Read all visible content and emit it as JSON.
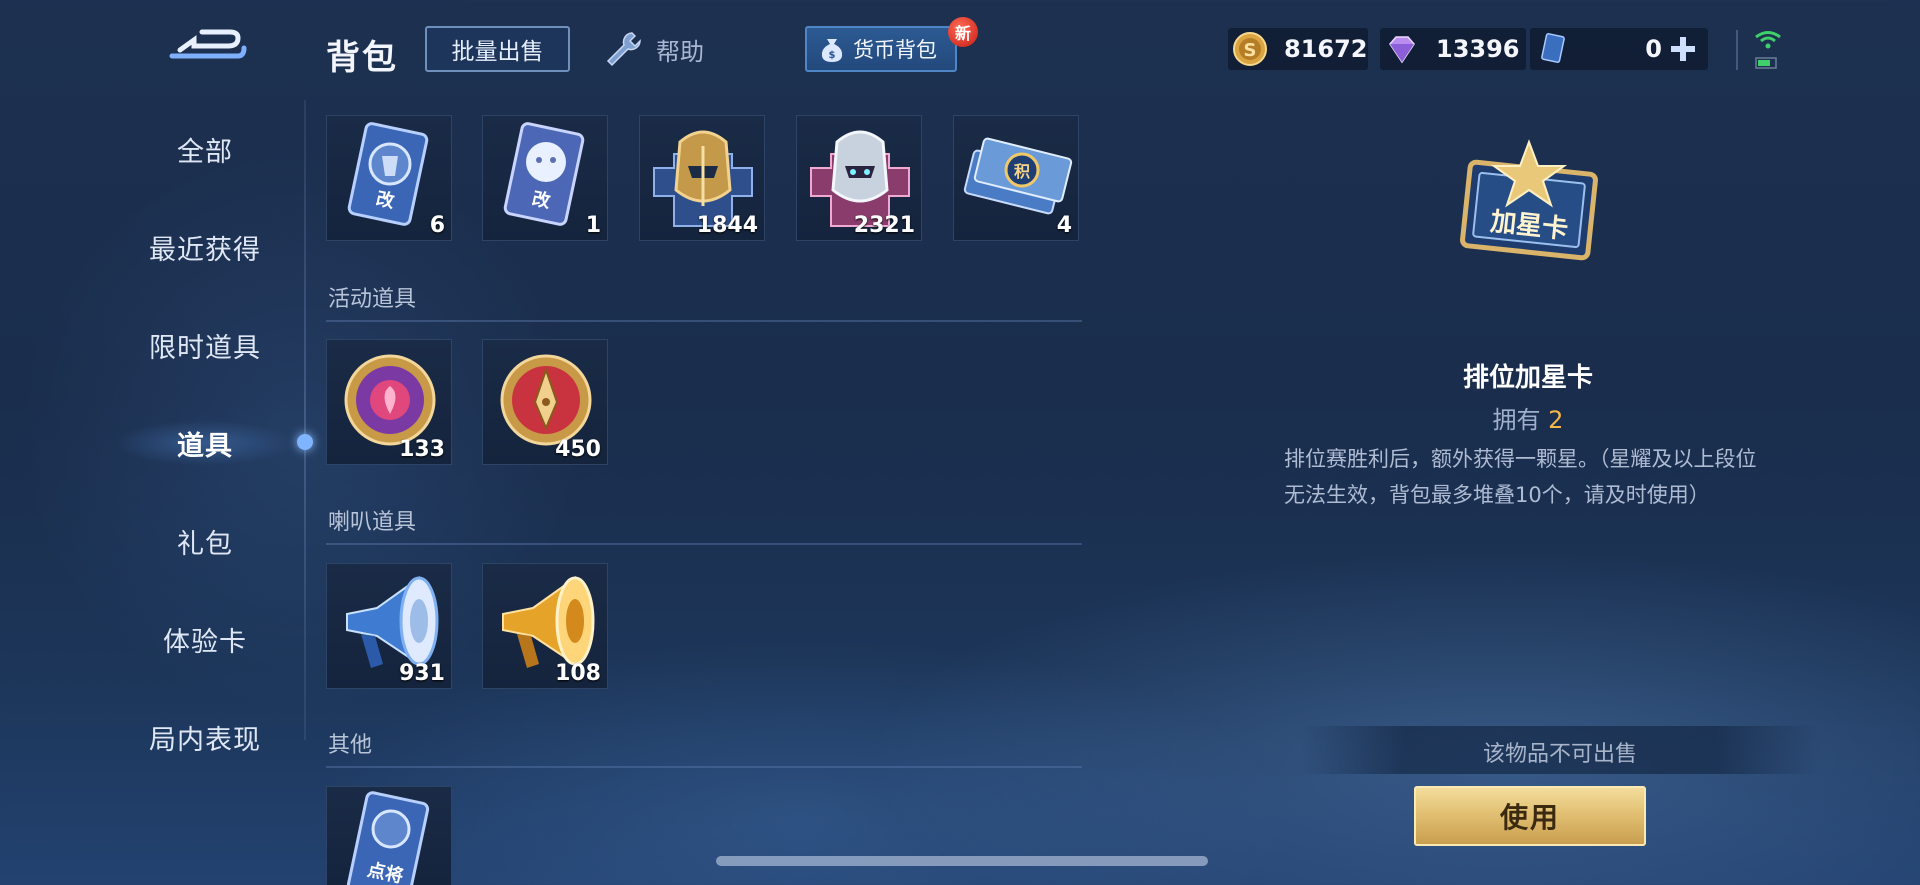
{
  "header": {
    "title": "背包",
    "batch_sell_label": "批量出售",
    "help_label": "帮助",
    "currency_bag_label": "货币背包",
    "new_badge": "新"
  },
  "currencies": {
    "gold": "81672",
    "diamond": "13396",
    "tickets": "0"
  },
  "sidebar": {
    "items": [
      {
        "label": "全部"
      },
      {
        "label": "最近获得"
      },
      {
        "label": "限时道具"
      },
      {
        "label": "道具"
      },
      {
        "label": "礼包"
      },
      {
        "label": "体验卡"
      },
      {
        "label": "局内表现"
      }
    ]
  },
  "sections": {
    "top_items": [
      {
        "icon": "blue-rename-card-icon",
        "count": "6"
      },
      {
        "icon": "pet-rename-card-icon",
        "count": "1"
      },
      {
        "icon": "gold-helmet-fragment-icon",
        "count": "1844"
      },
      {
        "icon": "pink-helmet-fragment-icon",
        "count": "2321"
      },
      {
        "icon": "ticket-card-icon",
        "count": "4"
      }
    ],
    "activity": {
      "title": "活动道具",
      "items": [
        {
          "icon": "rose-medal-icon",
          "count": "133"
        },
        {
          "icon": "pen-medal-icon",
          "count": "450"
        }
      ]
    },
    "speaker": {
      "title": "喇叭道具",
      "items": [
        {
          "icon": "blue-megaphone-icon",
          "count": "931"
        },
        {
          "icon": "gold-megaphone-icon",
          "count": "108"
        }
      ]
    },
    "other": {
      "title": "其他",
      "items": [
        {
          "icon": "general-card-icon",
          "label": "点将"
        }
      ]
    }
  },
  "detail": {
    "card_text": "加星卡",
    "name": "排位加星卡",
    "own_label": "拥有",
    "own_count": "2",
    "description": "排位赛胜利后，额外获得一颗星。（星耀及以上段位无法生效，背包最多堆叠10个，请及时使用）",
    "not_sellable": "该物品不可出售",
    "use_label": "使用"
  },
  "colors": {
    "accent_gold": "#f2b84a",
    "use_button": "#e2c073",
    "new_badge": "#c61d14"
  }
}
